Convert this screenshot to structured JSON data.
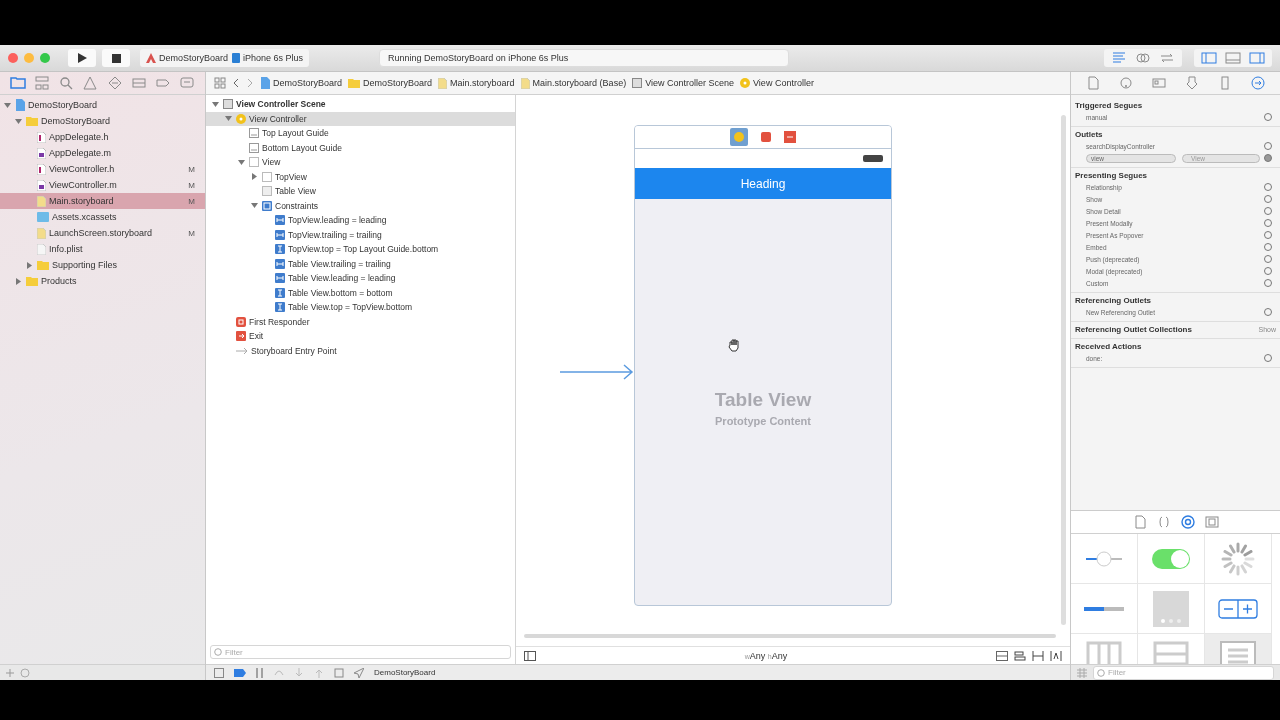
{
  "toolbar": {
    "run_button": {
      "enabled": true
    },
    "scheme": "DemoStoryBoard",
    "device": "iPhone 6s Plus",
    "status": "Running DemoStoryBoard on iPhone 6s Plus",
    "editor_modes": [
      {
        "kind": "standard",
        "selected": true
      },
      {
        "kind": "assistant",
        "selected": false
      },
      {
        "kind": "version",
        "selected": false
      }
    ],
    "panels": [
      {
        "kind": "navigator",
        "on": true
      },
      {
        "kind": "debug",
        "on": false
      },
      {
        "kind": "utilities",
        "on": true
      }
    ]
  },
  "navigator_tabs": [
    {
      "kind": "folder",
      "selected": true
    },
    {
      "kind": "hierarchy",
      "selected": false
    },
    {
      "kind": "search",
      "selected": false
    },
    {
      "kind": "warning",
      "selected": false
    },
    {
      "kind": "test",
      "selected": false
    },
    {
      "kind": "debug",
      "selected": false
    },
    {
      "kind": "breakpoint",
      "selected": false
    },
    {
      "kind": "report",
      "selected": false
    }
  ],
  "navigator": [
    {
      "label": "DemoStoryBoard",
      "kind": "project",
      "expanded": true,
      "selected": false,
      "children": [
        {
          "label": "DemoStoryBoard",
          "kind": "folder",
          "expanded": true,
          "selected": false,
          "children": [
            {
              "label": "AppDelegate.h",
              "kind": "header",
              "selected": false
            },
            {
              "label": "AppDelegate.m",
              "kind": "source",
              "selected": false
            },
            {
              "label": "ViewController.h",
              "kind": "header",
              "badge": "M",
              "selected": false
            },
            {
              "label": "ViewController.m",
              "kind": "source",
              "badge": "M",
              "selected": false
            },
            {
              "label": "Main.storyboard",
              "kind": "storyboard",
              "badge": "M",
              "selected": true
            },
            {
              "label": "Assets.xcassets",
              "kind": "assets",
              "selected": false
            },
            {
              "label": "LaunchScreen.storyboard",
              "kind": "storyboard",
              "badge": "M",
              "selected": false
            },
            {
              "label": "Info.plist",
              "kind": "plist",
              "selected": false
            },
            {
              "label": "Supporting Files",
              "kind": "folder",
              "expanded": false,
              "selected": false
            }
          ]
        },
        {
          "label": "Products",
          "kind": "folder",
          "expanded": false,
          "selected": false
        }
      ]
    }
  ],
  "jump_bar": [
    {
      "label": "DemoStoryBoard",
      "kind": "project"
    },
    {
      "label": "DemoStoryBoard",
      "kind": "folder"
    },
    {
      "label": "Main.storyboard",
      "kind": "storyboard"
    },
    {
      "label": "Main.storyboard (Base)",
      "kind": "storyboard"
    },
    {
      "label": "View Controller Scene",
      "kind": "scene"
    },
    {
      "label": "View Controller",
      "kind": "controller"
    }
  ],
  "outline": [
    {
      "label": "View Controller Scene",
      "kind": "scene",
      "expanded": true,
      "selected": false,
      "children": [
        {
          "label": "View Controller",
          "kind": "controller",
          "expanded": true,
          "selected": true,
          "children": [
            {
              "label": "Top Layout Guide",
              "kind": "guide",
              "selected": false
            },
            {
              "label": "Bottom Layout Guide",
              "kind": "guide",
              "selected": false
            },
            {
              "label": "View",
              "kind": "view",
              "expanded": true,
              "selected": false,
              "children": [
                {
                  "label": "TopView",
                  "kind": "view",
                  "expanded": false,
                  "selected": false
                },
                {
                  "label": "Table View",
                  "kind": "table",
                  "selected": false
                },
                {
                  "label": "Constraints",
                  "kind": "constraints",
                  "expanded": true,
                  "selected": false,
                  "children": [
                    {
                      "label": "TopView.leading = leading",
                      "kind": "h-constraint",
                      "selected": false
                    },
                    {
                      "label": "TopView.trailing = trailing",
                      "kind": "h-constraint",
                      "selected": false
                    },
                    {
                      "label": "TopView.top = Top Layout Guide.bottom",
                      "kind": "v-constraint",
                      "selected": false
                    },
                    {
                      "label": "Table View.trailing = trailing",
                      "kind": "h-constraint",
                      "selected": false
                    },
                    {
                      "label": "Table View.leading = leading",
                      "kind": "h-constraint",
                      "selected": false
                    },
                    {
                      "label": "Table View.bottom = bottom",
                      "kind": "v-constraint",
                      "selected": false
                    },
                    {
                      "label": "Table View.top = TopView.bottom",
                      "kind": "v-constraint",
                      "selected": false
                    }
                  ]
                }
              ]
            }
          ]
        },
        {
          "label": "First Responder",
          "kind": "responder",
          "selected": false
        },
        {
          "label": "Exit",
          "kind": "exit",
          "selected": false
        },
        {
          "label": "Storyboard Entry Point",
          "kind": "entry",
          "selected": false
        }
      ]
    }
  ],
  "outline_filter": {
    "placeholder": "Filter"
  },
  "canvas": {
    "heading": "Heading",
    "table_title": "Table View",
    "table_subtitle": "Prototype Content",
    "size_class": [
      {
        "prefix": "w",
        "value": "Any"
      },
      {
        "prefix": "h",
        "value": "Any"
      }
    ]
  },
  "inspector_tabs": [
    {
      "kind": "file",
      "selected": false
    },
    {
      "kind": "help",
      "selected": false
    },
    {
      "kind": "identity",
      "selected": false
    },
    {
      "kind": "attributes",
      "selected": false
    },
    {
      "kind": "size",
      "selected": false
    },
    {
      "kind": "connections",
      "selected": true
    }
  ],
  "connections": [
    {
      "title": "Triggered Segues",
      "rows": [
        {
          "label": "manual",
          "connected": false
        }
      ]
    },
    {
      "title": "Outlets",
      "rows": [
        {
          "label": "searchDisplayController",
          "connected": false
        },
        {
          "label": "view",
          "connected": true,
          "target": "View"
        }
      ]
    },
    {
      "title": "Presenting Segues",
      "rows": [
        {
          "label": "Relationship",
          "connected": false
        },
        {
          "label": "Show",
          "connected": false
        },
        {
          "label": "Show Detail",
          "connected": false
        },
        {
          "label": "Present Modally",
          "connected": false
        },
        {
          "label": "Present As Popover",
          "connected": false
        },
        {
          "label": "Embed",
          "connected": false
        },
        {
          "label": "Push (deprecated)",
          "connected": false
        },
        {
          "label": "Modal (deprecated)",
          "connected": false
        },
        {
          "label": "Custom",
          "connected": false
        }
      ]
    },
    {
      "title": "Referencing Outlets",
      "rows": [
        {
          "label": "New Referencing Outlet",
          "connected": false
        }
      ]
    },
    {
      "title": "Referencing Outlet Collections",
      "action": "Show"
    },
    {
      "title": "Received Actions",
      "rows": [
        {
          "label": "done:",
          "connected": false
        }
      ]
    }
  ],
  "library_tabs": [
    {
      "kind": "file",
      "selected": false
    },
    {
      "kind": "code",
      "selected": false
    },
    {
      "kind": "object",
      "selected": true
    },
    {
      "kind": "media",
      "selected": false
    }
  ],
  "library": [
    {
      "kind": "slider",
      "selected": false
    },
    {
      "kind": "switch",
      "selected": false
    },
    {
      "kind": "activity",
      "selected": false
    },
    {
      "kind": "progress",
      "selected": false
    },
    {
      "kind": "page-control",
      "selected": false
    },
    {
      "kind": "stepper",
      "selected": false
    },
    {
      "kind": "collection",
      "selected": false
    },
    {
      "kind": "table",
      "selected": false
    },
    {
      "kind": "table-cell",
      "selected": true
    }
  ],
  "library_filter": {
    "placeholder": "Filter"
  },
  "debug_bar": {
    "target": "DemoStoryBoard"
  }
}
